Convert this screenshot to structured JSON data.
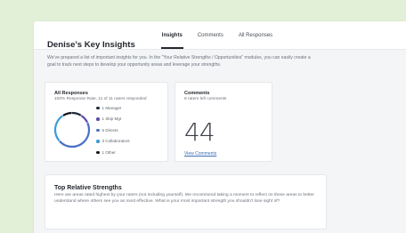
{
  "nav": {
    "tabs": [
      {
        "label": "Insights",
        "active": true
      },
      {
        "label": "Comments",
        "active": false
      },
      {
        "label": "All Responses",
        "active": false
      }
    ]
  },
  "main": {
    "title": "Denise's Key Insights",
    "description": "We've prepared a list of important insights for you. In the \"Your Relative Strengths / Opportunities\" modules, you can easily create a goal to track next steps to develop your opportunity areas and leverage your strengths."
  },
  "responses_card": {
    "title": "All Responses",
    "subtitle": "100% Response Rate, 11 of 11 raters responded",
    "legend": [
      {
        "label": "1 Manager",
        "count": 1,
        "color": "#1f2a3a"
      },
      {
        "label": "1 Skip Mgr",
        "count": 1,
        "color": "#5b4bb0"
      },
      {
        "label": "5 Directs",
        "count": 5,
        "color": "#4a6fc8"
      },
      {
        "label": "3 Collaborators",
        "count": 3,
        "color": "#3a9ad6"
      },
      {
        "label": "1 Other",
        "count": 1,
        "color": "#12161c"
      }
    ]
  },
  "comments_card": {
    "title": "Comments",
    "subtitle": "8 raters left comments",
    "count": "44",
    "link_label": "View Comments"
  },
  "strengths": {
    "title": "Top Relative Strengths",
    "description": "Here are areas rated highest by your raters (not including yourself). We recommend taking a moment to reflect on these areas to better understand where others see you as most effective. What is your most important strength you shouldn't lose sight of?"
  }
}
